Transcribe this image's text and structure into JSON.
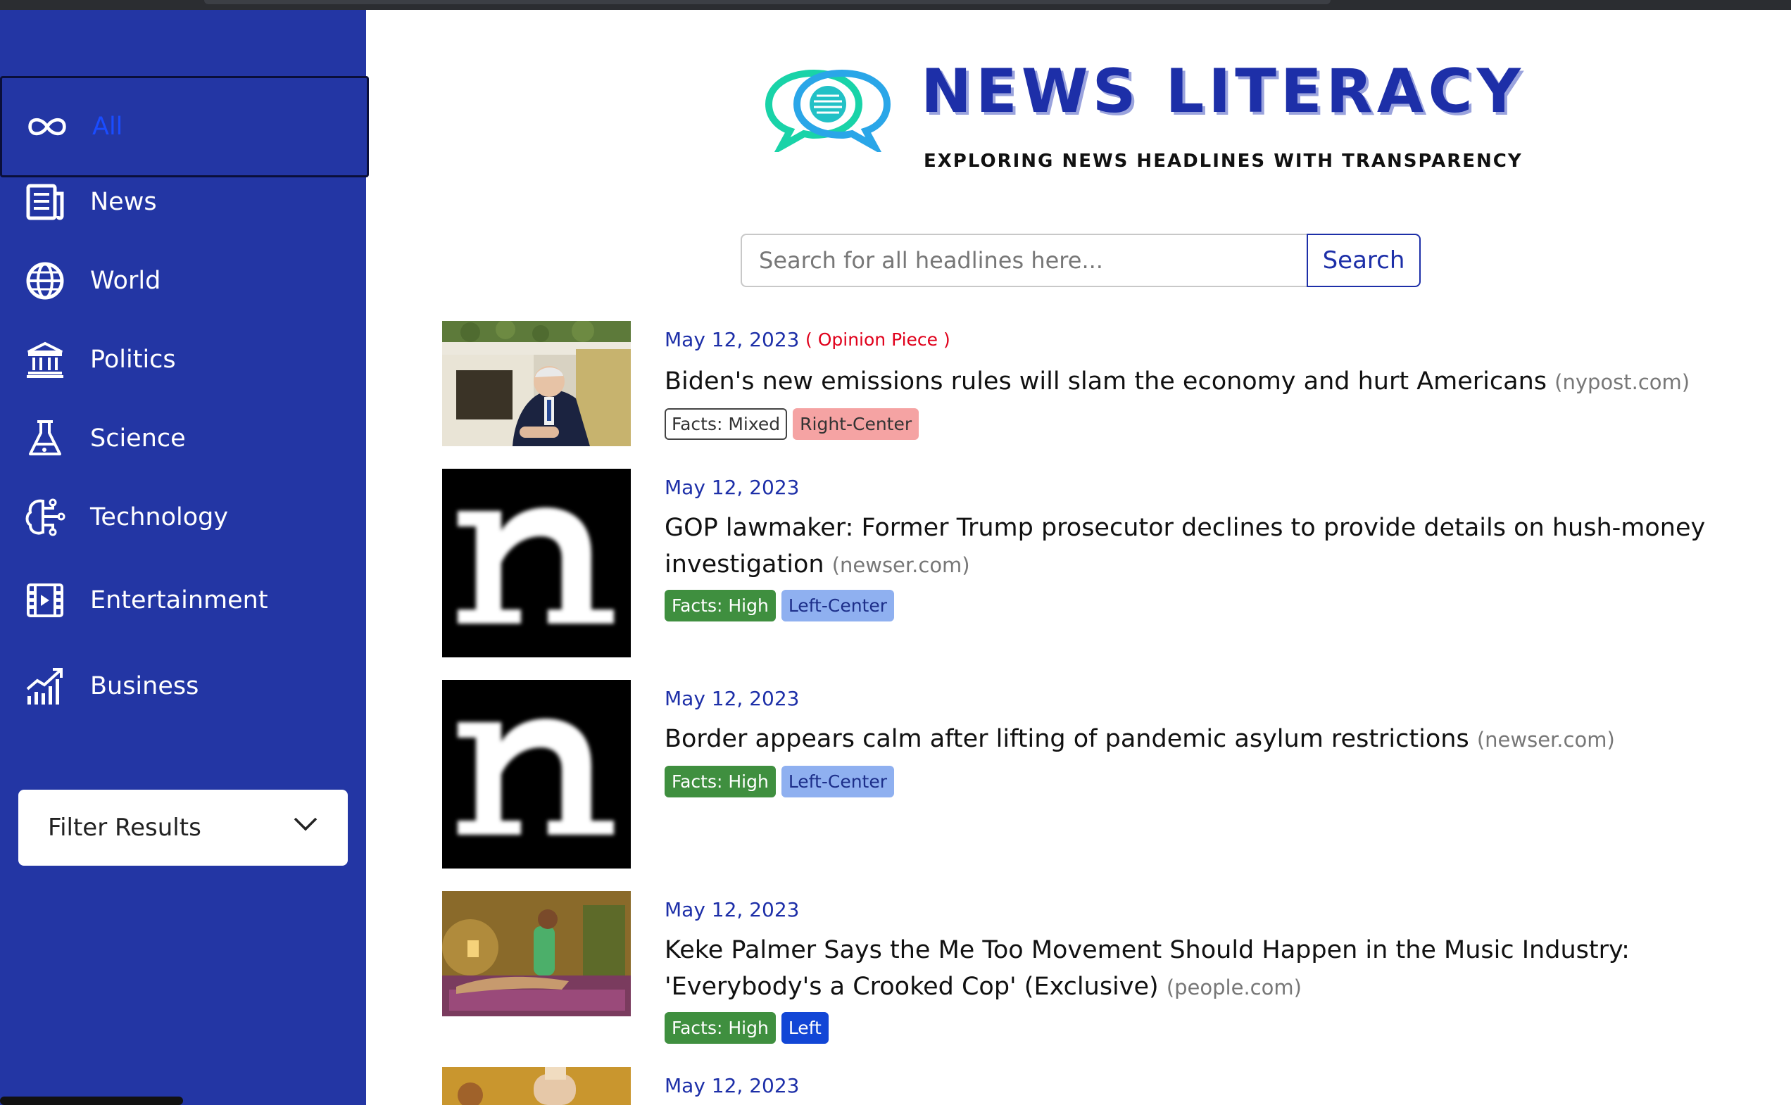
{
  "sidebar": {
    "items": [
      {
        "label": "All",
        "icon": "infinity-icon"
      },
      {
        "label": "News",
        "icon": "newspaper-icon"
      },
      {
        "label": "World",
        "icon": "globe-icon"
      },
      {
        "label": "Politics",
        "icon": "bank-icon"
      },
      {
        "label": "Science",
        "icon": "flask-icon"
      },
      {
        "label": "Technology",
        "icon": "brain-circuit-icon"
      },
      {
        "label": "Entertainment",
        "icon": "film-icon"
      },
      {
        "label": "Business",
        "icon": "chart-growth-icon"
      }
    ],
    "filter_label": "Filter Results"
  },
  "brand": {
    "title": "NEWS LITERACY",
    "subtitle": "EXPLORING NEWS HEADLINES WITH TRANSPARENCY"
  },
  "search": {
    "placeholder": "Search for all headlines here...",
    "button_label": "Search"
  },
  "articles": [
    {
      "date": "May 12, 2023",
      "opinion": "( Opinion Piece )",
      "title": "Biden's new emissions rules will slam the economy and hurt Americans",
      "source": "(nypost.com)",
      "facts": "Facts: Mixed",
      "bias": "Right-Center"
    },
    {
      "date": "May 12, 2023",
      "title": "GOP lawmaker: Former Trump prosecutor declines to provide details on hush-money investigation",
      "source": "(newser.com)",
      "facts": "Facts: High",
      "bias": "Left-Center"
    },
    {
      "date": "May 12, 2023",
      "title": "Border appears calm after lifting of pandemic asylum restrictions",
      "source": "(newser.com)",
      "facts": "Facts: High",
      "bias": "Left-Center"
    },
    {
      "date": "May 12, 2023",
      "title": "Keke Palmer Says the Me Too Movement Should Happen in the Music Industry: 'Everybody's a Crooked Cop' (Exclusive)",
      "source": "(people.com)",
      "facts": "Facts: High",
      "bias": "Left"
    },
    {
      "date": "May 12, 2023"
    }
  ],
  "colors": {
    "sidebar": "#2336a4",
    "brand": "#1d2fa8",
    "logo_teal": "#19d3a8",
    "logo_blue": "#2aa6e8",
    "opinion": "#e0001b"
  }
}
